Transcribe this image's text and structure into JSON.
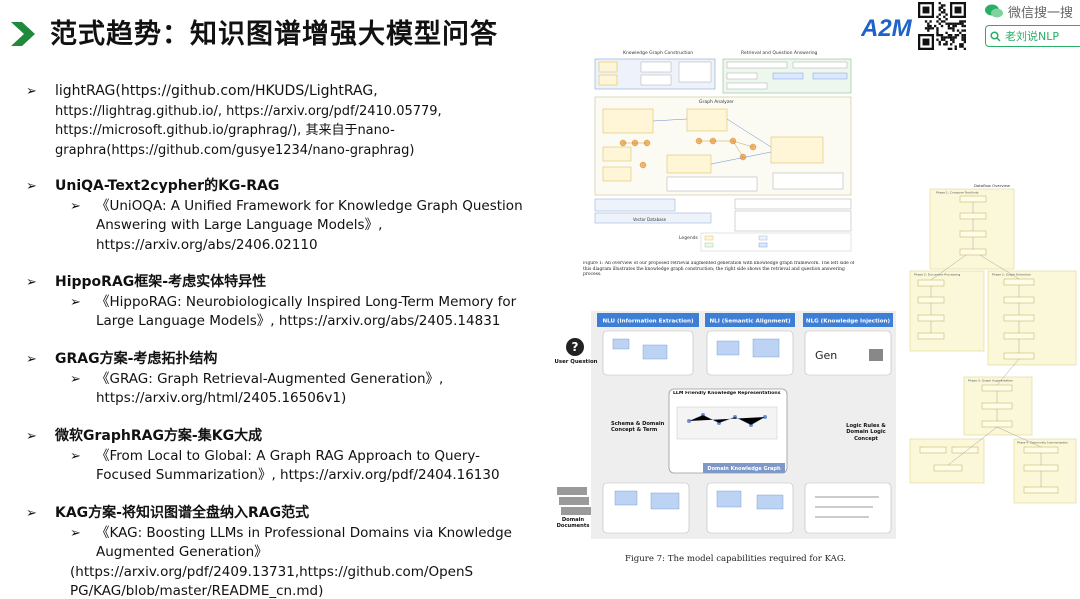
{
  "header": {
    "title": "范式趋势：知识图谱增强大模型问答",
    "logo_text": "A2M",
    "wechat_label": "微信搜一搜",
    "search_text": "老刘说NLP"
  },
  "items": [
    {
      "heading": "lightRAG(https://github.com/HKUDS/LightRAG,",
      "lines": [
        "https://lightrag.github.io/, https://arxiv.org/pdf/2410.05779,",
        "https://microsoft.github.io/graphrag/), 其来自于nano-",
        "graphra(https://github.com/gusye1234/nano-graphrag)"
      ],
      "subs": []
    },
    {
      "heading": "UniQA-Text2cypher的KG-RAG",
      "lines": [],
      "subs": [
        [
          "《UniOQA: A Unified Framework for Knowledge Graph Question",
          "Answering with Large Language Models》,",
          "https://arxiv.org/abs/2406.02110"
        ]
      ]
    },
    {
      "heading": "HippoRAG框架-考虑实体特异性",
      "lines": [],
      "subs": [
        [
          "《HippoRAG: Neurobiologically Inspired Long-Term Memory for",
          "Large Language Models》, https://arxiv.org/abs/2405.14831"
        ]
      ]
    },
    {
      "heading": "GRAG方案-考虑拓扑结构",
      "lines": [],
      "subs": [
        [
          "《GRAG: Graph Retrieval-Augmented Generation》,",
          "https://arxiv.org/html/2405.16506v1)"
        ]
      ]
    },
    {
      "heading": "微软GraphRAG方案-集KG大成",
      "lines": [],
      "subs": [
        [
          "《From Local to Global: A Graph RAG Approach to Query-",
          "Focused Summarization》, https://arxiv.org/pdf/2404.16130"
        ]
      ]
    },
    {
      "heading": "KAG方案-将知识图谱全盘纳入RAG范式",
      "lines": [],
      "subs": [
        [
          "《KAG: Boosting LLMs in Professional Domains via Knowledge",
          "Augmented Generation》",
          "(https://arxiv.org/pdf/2409.13731,https://github.com/OpenS",
          "PG/KAG/blob/master/README_cn.md)"
        ]
      ]
    }
  ],
  "fig1": {
    "left_head": "Knowledge Graph Construction",
    "right_head": "Retrieval and Question Answering",
    "mid_label": "Graph Analyzer",
    "bottom_label": "Vector Database",
    "legends": "Legends",
    "caption": "Figure 1: An overview of our proposed retrieval augmented generation with knowledge graph framework. The left side of this diagram illustrates the knowledge graph construction; the right side shows the retrieval and question answering process."
  },
  "fig2": {
    "col1": "NLU (Information Extraction)",
    "col2": "NLI (Semantic Alignment)",
    "col3": "NLG (Knowledge Injection)",
    "user_question": "User Question",
    "center_top": "LLM Friendly Knowledge Representations",
    "center_bottom": "Domain Knowledge Graph",
    "schema": "Schema & Domain Concept & Term",
    "logic": "Logic Rules & Domain Logic Concept",
    "domain_docs": "Domain Documents",
    "gen": "Gen",
    "caption": "Figure 7: The model capabilities required for KAG."
  },
  "fig3": {
    "title": "Dataflow Overview",
    "phase1": "Phase 1: Compose TextUnits",
    "phase2": "Phase 2: Graph Extraction",
    "phase3": "Phase 3: Graph Augmentation",
    "phase4": "Phase 4: Community Summarization"
  }
}
